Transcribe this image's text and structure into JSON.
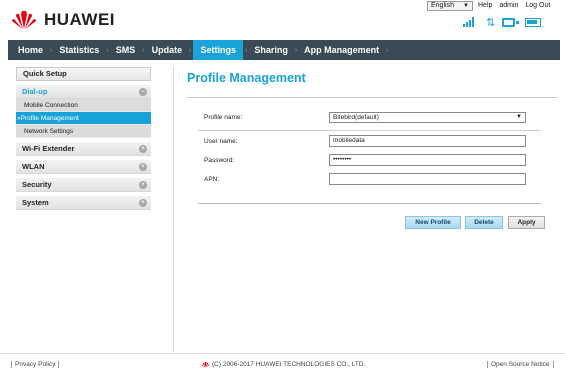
{
  "header": {
    "brand": "HUAWEI",
    "language": "English",
    "links": [
      "Help",
      "admin",
      "Log Out"
    ],
    "brand_color": "#e60012",
    "icons": [
      "signal-icon",
      "transfer-icon",
      "pc-icon",
      "battery-icon"
    ]
  },
  "nav": {
    "items": [
      "Home",
      "Statistics",
      "SMS",
      "Update",
      "Settings",
      "Sharing",
      "App Management"
    ],
    "active": "Settings"
  },
  "sidebar": {
    "quick_setup": "Quick Setup",
    "groups": [
      {
        "label": "Dial-up",
        "icon": "minus-circle-icon",
        "items": [
          "Mobile Connection",
          "Profile Management",
          "Network Settings"
        ],
        "active_item": "Profile Management"
      },
      {
        "label": "Wi-Fi Extender",
        "icon": "plus-circle-icon"
      },
      {
        "label": "WLAN",
        "icon": "plus-circle-icon"
      },
      {
        "label": "Security",
        "icon": "plus-circle-icon"
      },
      {
        "label": "System",
        "icon": "plus-circle-icon"
      }
    ]
  },
  "main": {
    "title": "Profile Management",
    "profile_name_label": "Profile name:",
    "profile_name_value": "Bitebird(default)",
    "username_label": "User name:",
    "username_value": "mobiledata",
    "password_label": "Password:",
    "password_value": "••••••••",
    "apn_label": "APN:",
    "apn_value": "",
    "buttons": {
      "new_profile": "New Profile",
      "delete": "Delete",
      "apply": "Apply"
    }
  },
  "footer": {
    "privacy": "Privacy Policy",
    "copyright": "(C) 2006-2017 HUAWEI TECHNOLOGIES CO., LTD.",
    "open_source": "Open Source Notice"
  },
  "colors": {
    "accent": "#1aa3d8",
    "nav_bg": "#3a4b55"
  }
}
